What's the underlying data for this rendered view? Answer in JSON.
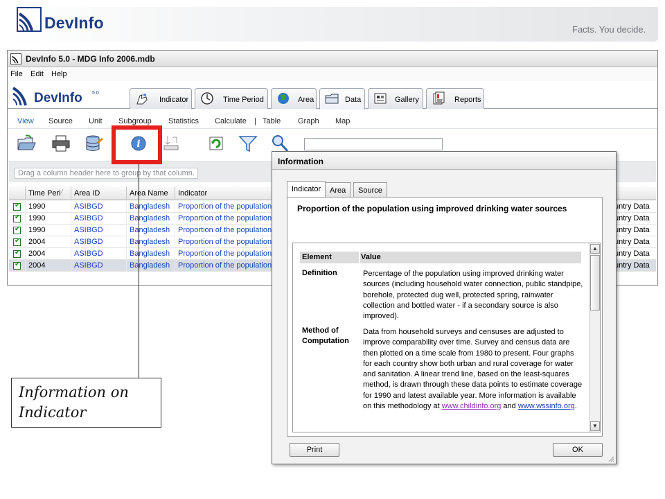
{
  "slide": {
    "logo_text": "DevInfo",
    "tagline": "Facts. You decide."
  },
  "app": {
    "title": "DevInfo 5.0 - MDG Info 2006.mdb",
    "menu": [
      "File",
      "Edit",
      "Help"
    ],
    "logo_text": "DevInfo",
    "logo_version": "5.0",
    "tabs": [
      {
        "label": "Indicator",
        "icon": "hand-pointer-icon"
      },
      {
        "label": "Time Period",
        "icon": "clock-icon"
      },
      {
        "label": "Area",
        "icon": "globe-icon"
      },
      {
        "label": "Data",
        "icon": "folder-icon"
      },
      {
        "label": "Gallery",
        "icon": "gallery-icon"
      },
      {
        "label": "Reports",
        "icon": "reports-icon"
      }
    ],
    "subnav": [
      "View",
      "Source",
      "Unit",
      "Subgroup",
      "Statistics",
      "Calculate",
      "|",
      "Table",
      "Graph",
      "Map"
    ],
    "group_hint": "Drag a column header here to group by that column.",
    "grid": {
      "columns": [
        "Time Peri",
        "Area ID",
        "Area Name",
        "Indicator"
      ],
      "rows": [
        {
          "time": "1990",
          "area_id": "ASIBGD",
          "area_name": "Bangladesh",
          "indicator": "Proportion of the population",
          "extra": "untry Data"
        },
        {
          "time": "1990",
          "area_id": "ASIBGD",
          "area_name": "Bangladesh",
          "indicator": "Proportion of the population",
          "extra": "untry Data"
        },
        {
          "time": "1990",
          "area_id": "ASIBGD",
          "area_name": "Bangladesh",
          "indicator": "Proportion of the population",
          "extra": "untry Data"
        },
        {
          "time": "2004",
          "area_id": "ASIBGD",
          "area_name": "Bangladesh",
          "indicator": "Proportion of the population",
          "extra": "untry Data"
        },
        {
          "time": "2004",
          "area_id": "ASIBGD",
          "area_name": "Bangladesh",
          "indicator": "Proportion of the population",
          "extra": "untry Data"
        },
        {
          "time": "2004",
          "area_id": "ASIBGD",
          "area_name": "Bangladesh",
          "indicator": "Proportion of the population",
          "extra": "untry Data"
        }
      ]
    }
  },
  "callout": {
    "line1": "Information on",
    "line2": "Indicator"
  },
  "dialog": {
    "title": "Information",
    "tabs": [
      "Indicator",
      "Area",
      "Source"
    ],
    "indicator_title": "Proportion of the population using improved drinking water sources",
    "table_head": {
      "element": "Element",
      "value": "Value"
    },
    "definition_label": "Definition",
    "definition_text": "Percentage of the population using improved drinking water sources (including household water connection, public standpipe, borehole, protected dug well, protected spring, rainwater collection and bottled water - if a secondary source is also improved).",
    "method_label_1": "Method of",
    "method_label_2": "Computation",
    "method_text": "Data from household surveys and censuses are adjusted to improve comparability over time. Survey and census data are then plotted on a time scale from 1980 to present. Four graphs for each country show both urban and rural coverage for water and sanitation. A linear trend line, based on the least-squares method, is drawn through these data points to estimate coverage for 1990 and latest available year. More information is available on this methodology at",
    "link1": "www.childinfo.org",
    "and_text": "and",
    "link2": "www.wssinfo.org",
    "print_label": "Print",
    "ok_label": "OK"
  },
  "colors": {
    "brand": "#1d3e85",
    "highlight": "#e61f1f",
    "link": "#1a3fb8"
  }
}
